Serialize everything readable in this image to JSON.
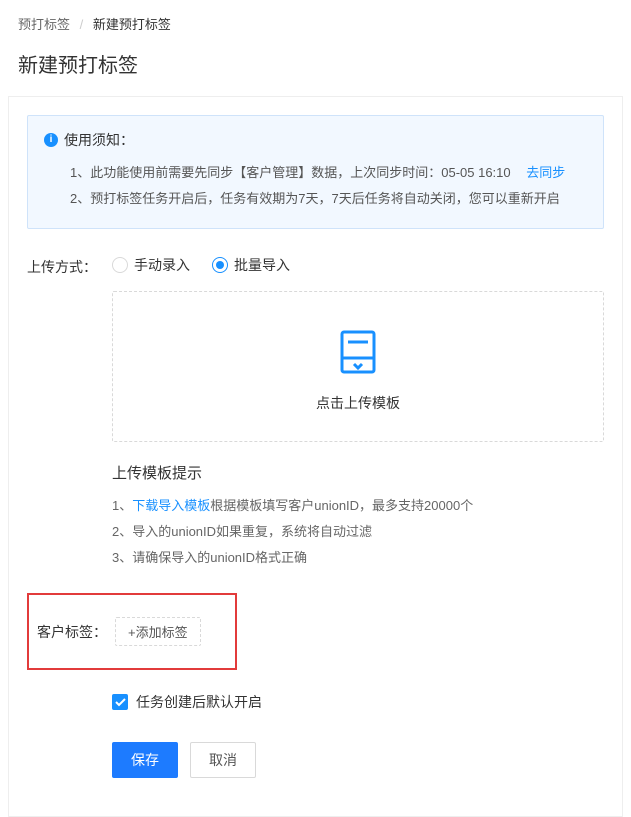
{
  "breadcrumb": {
    "parent": "预打标签",
    "current": "新建预打标签"
  },
  "page_title": "新建预打标签",
  "notice": {
    "title": "使用须知：",
    "item1_prefix": "1、此功能使用前需要先同步【客户管理】数据，上次同步时间：",
    "sync_time": "05-05 16:10",
    "sync_link": "去同步",
    "item2": "2、预打标签任务开启后，任务有效期为7天，7天后任务将自动关闭，您可以重新开启"
  },
  "upload_method": {
    "label": "上传方式：",
    "option_manual": "手动录入",
    "option_batch": "批量导入",
    "selected": "batch"
  },
  "upload_box": {
    "text": "点击上传模板"
  },
  "tips": {
    "title": "上传模板提示",
    "item1_prefix": "1、",
    "item1_link": "下载导入模板",
    "item1_suffix": "根据模板填写客户unionID，最多支持20000个",
    "item2": "2、导入的unionID如果重复，系统将自动过滤",
    "item3": "3、请确保导入的unionID格式正确"
  },
  "customer_tag": {
    "label": "客户标签：",
    "add_btn": "+添加标签"
  },
  "auto_enable": {
    "label": "任务创建后默认开启",
    "checked": true
  },
  "buttons": {
    "save": "保存",
    "cancel": "取消"
  }
}
